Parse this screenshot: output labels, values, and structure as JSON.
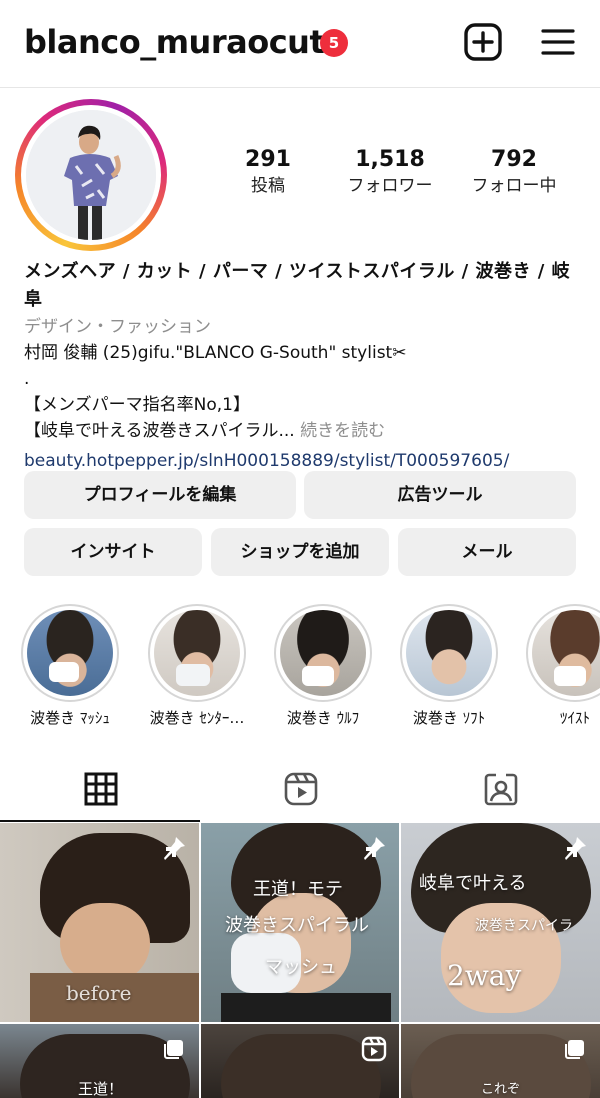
{
  "header": {
    "username": "blanco_muraocut",
    "notification_count": "5",
    "add_icon": "plus-square-icon",
    "menu_icon": "hamburger-icon"
  },
  "stats": [
    {
      "value": "291",
      "label": "投稿"
    },
    {
      "value": "1,518",
      "label": "フォロワー"
    },
    {
      "value": "792",
      "label": "フォロー中"
    }
  ],
  "bio": {
    "name": "メンズヘア / カット / パーマ / ツイストスパイラル / 波巻き / 岐阜",
    "category": "デザイン・ファッション",
    "line1": "村岡 俊輔 (25)gifu.\"BLANCO G-South\" stylist✂",
    "line2": ".",
    "line3": "【メンズパーマ指名率No,1】",
    "line4": "【岐阜で叶える波巻きスパイラル...",
    "more": "続きを読む",
    "link": "beauty.hotpepper.jp/slnH000158889/stylist/T000597605/"
  },
  "buttons": {
    "edit_profile": "プロフィールを編集",
    "ad_tools": "広告ツール",
    "insights": "インサイト",
    "add_shop": "ショップを追加",
    "email": "メール"
  },
  "highlights": [
    {
      "label": "波巻き ﾏｯｼｭ"
    },
    {
      "label": "波巻き ｾﾝﾀｰ…"
    },
    {
      "label": "波巻き ｳﾙﾌ"
    },
    {
      "label": "波巻き ｿﾌﾄ"
    },
    {
      "label": "ﾂｲｽﾄ"
    }
  ],
  "tabs": [
    "grid-icon",
    "reels-icon",
    "tagged-icon"
  ],
  "posts": [
    {
      "overlay": "before",
      "pinned": true
    },
    {
      "overlay1": "王道！モテ",
      "overlay2": "波巻きスパイラル",
      "overlay3": "マッシュ",
      "pinned": true
    },
    {
      "overlay1": "岐阜で叶える",
      "overlay2": "波巻きスパイラ",
      "overlay3": "2way",
      "pinned": true
    },
    {
      "overlay": "王道！",
      "multi": true
    },
    {
      "reel": true
    },
    {
      "overlay": "これぞ",
      "multi": true
    }
  ],
  "colors": {
    "badge": "#ee2e3c",
    "link": "#1f3a6d",
    "button_bg": "#efefef",
    "muted": "#8e8e8e"
  }
}
